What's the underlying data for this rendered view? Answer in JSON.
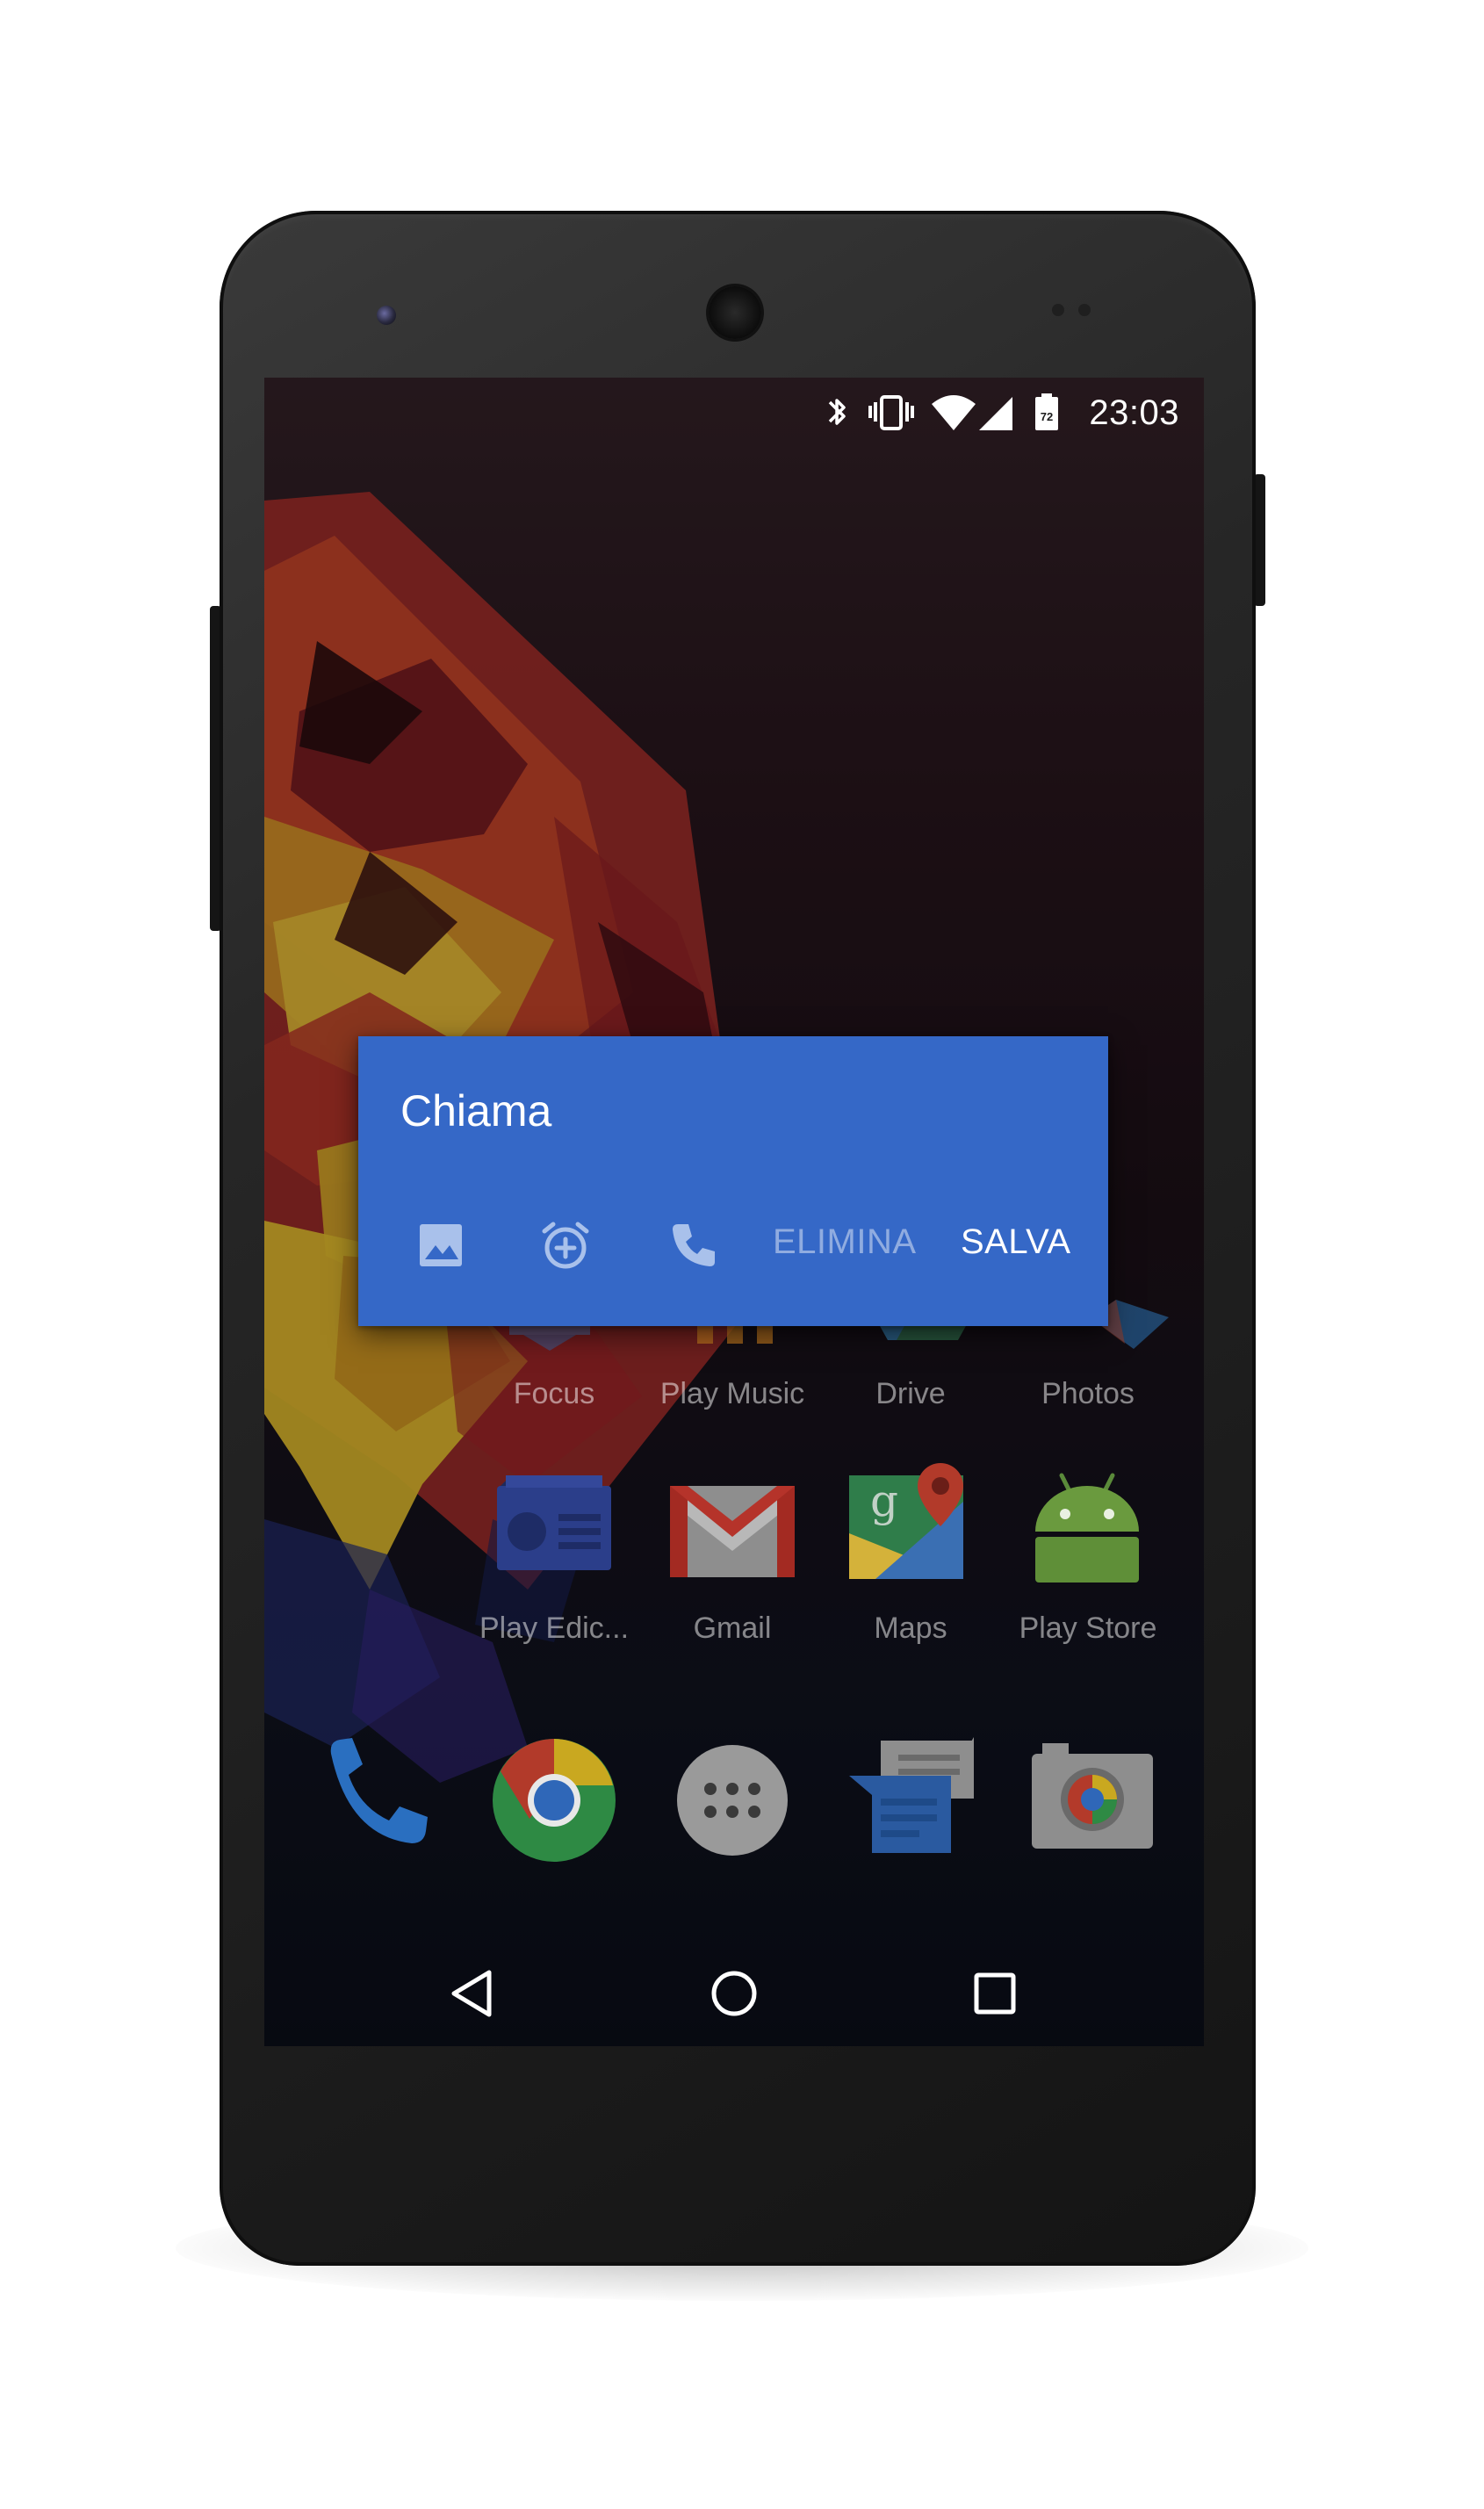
{
  "status_bar": {
    "time": "23:03",
    "battery_level": "72",
    "icons": [
      "bluetooth-icon",
      "vibrate-icon",
      "wifi-icon",
      "cell-signal-icon",
      "battery-icon"
    ]
  },
  "app_grid": {
    "row1": [
      {
        "label": "Focus",
        "icon": "focus-app-icon"
      },
      {
        "label": "Play Music",
        "icon": "play-music-app-icon"
      },
      {
        "label": "Drive",
        "icon": "drive-app-icon"
      },
      {
        "label": "Photos",
        "icon": "photos-app-icon"
      }
    ],
    "row2": [
      {
        "label": "Play Edic...",
        "icon": "play-edicola-app-icon"
      },
      {
        "label": "Gmail",
        "icon": "gmail-app-icon"
      },
      {
        "label": "Maps",
        "icon": "maps-app-icon"
      },
      {
        "label": "Play Store",
        "icon": "play-store-app-icon"
      }
    ]
  },
  "dock": [
    "phone-app-icon",
    "chrome-app-icon",
    "app-drawer-icon",
    "messenger-app-icon",
    "camera-app-icon"
  ],
  "dialog": {
    "title": "Chiama",
    "actions": {
      "image_icon": "image-icon",
      "reminder_icon": "alarm-add-icon",
      "call_icon": "phone-icon",
      "delete_label": "ELIMINA",
      "save_label": "SALVA"
    },
    "color": "#3568c7"
  },
  "nav_bar": [
    "back-icon",
    "home-icon",
    "recents-icon"
  ]
}
